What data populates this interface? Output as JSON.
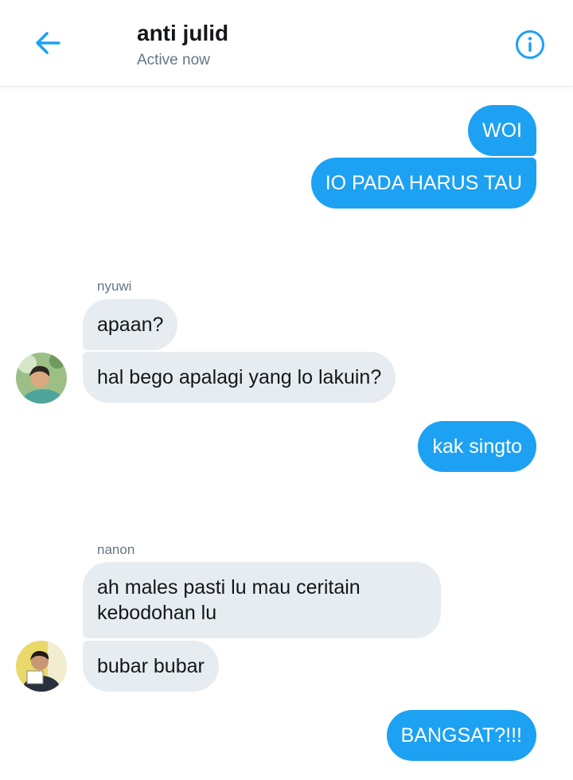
{
  "header": {
    "title": "anti julid",
    "status": "Active now",
    "back_icon": "arrow-left-icon",
    "info_icon": "info-circle-icon"
  },
  "colors": {
    "accent": "#1da1f2",
    "incoming_bubble": "#e6ecf0",
    "primary_text": "#14171a",
    "secondary_text": "#657786"
  },
  "messages": [
    {
      "direction": "out",
      "text": "WOI"
    },
    {
      "direction": "out",
      "text": "IO PADA HARUS TAU"
    },
    {
      "direction": "in",
      "sender": "nyuwi",
      "text": "apaan?"
    },
    {
      "direction": "in",
      "sender": "nyuwi",
      "text": "hal bego apalagi yang lo lakuin?"
    },
    {
      "direction": "out",
      "text": "kak singto"
    },
    {
      "direction": "in",
      "sender": "nanon",
      "text": "ah males pasti lu mau ceritain kebodohan lu"
    },
    {
      "direction": "in",
      "sender": "nanon",
      "text": "bubar bubar"
    },
    {
      "direction": "out",
      "text": "BANGSAT?!!!"
    }
  ]
}
